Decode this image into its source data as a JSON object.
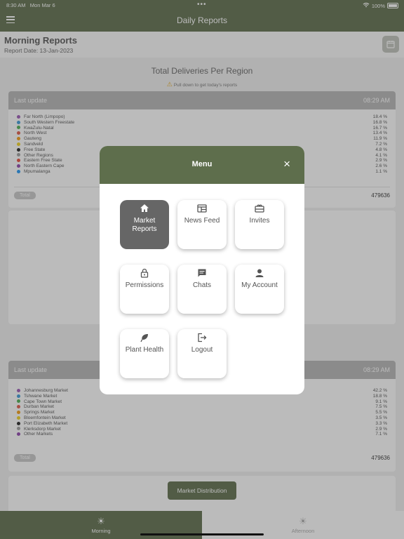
{
  "status_bar": {
    "time": "8:30 AM",
    "date": "Mon Mar 6",
    "battery": "100%"
  },
  "nav": {
    "title": "Daily Reports"
  },
  "header": {
    "title": "Morning Reports",
    "report_date": "Report Date: 13-Jan-2023"
  },
  "section": {
    "title": "Total Deliveries Per Region",
    "hint": "Pull down to get today's reports"
  },
  "region_card": {
    "last_update_label": "Last update",
    "time": "08:29 AM",
    "total_label": "Total",
    "total_value": "479636",
    "items": [
      {
        "name": "Far North (Limpopo)",
        "percent": "18.4 %",
        "color": "#9b59b6"
      },
      {
        "name": "South Western Freestate",
        "percent": "16.8 %",
        "color": "#3b9ad9"
      },
      {
        "name": "KwaZulu-Natal",
        "percent": "16.7 %",
        "color": "#4caf50"
      },
      {
        "name": "North West",
        "percent": "13.4 %",
        "color": "#e05a47"
      },
      {
        "name": "Gauteng",
        "percent": "11.9 %",
        "color": "#f39c12"
      },
      {
        "name": "Sandveld",
        "percent": "7.2 %",
        "color": "#f1d321"
      },
      {
        "name": "Free State",
        "percent": "4.8 %",
        "color": "#222222"
      },
      {
        "name": "Other Regions",
        "percent": "4.1 %",
        "color": "#9e9e9e"
      },
      {
        "name": "Eastern Free State",
        "percent": "2.9 %",
        "color": "#e74c3c"
      },
      {
        "name": "North Eastern Cape",
        "percent": "2.6 %",
        "color": "#8e44ad"
      },
      {
        "name": "Mpumalanga",
        "percent": "1.1 %",
        "color": "#2196f3"
      }
    ]
  },
  "market_card": {
    "last_update_label": "Last update",
    "time": "08:29 AM",
    "total_label": "Total",
    "total_value": "479636",
    "items": [
      {
        "name": "Johannesburg Market",
        "percent": "42.2 %",
        "color": "#9b59b6"
      },
      {
        "name": "Tshwane Market",
        "percent": "18.8 %",
        "color": "#3b9ad9"
      },
      {
        "name": "Cape Town Market",
        "percent": "9.1 %",
        "color": "#4caf50"
      },
      {
        "name": "Durban Market",
        "percent": "7.5 %",
        "color": "#e05a47"
      },
      {
        "name": "Springs Market",
        "percent": "5.5 %",
        "color": "#f39c12"
      },
      {
        "name": "Bloemfontein Market",
        "percent": "3.5 %",
        "color": "#f1d321"
      },
      {
        "name": "Port Elizabeth Market",
        "percent": "3.3 %",
        "color": "#222222"
      },
      {
        "name": "Klerksdorp Market",
        "percent": "2.9 %",
        "color": "#9e9e9e"
      },
      {
        "name": "Other Markets",
        "percent": "7.1 %",
        "color": "#8e44ad"
      }
    ]
  },
  "market_distribution_button": "Market Distribution",
  "tabs": {
    "morning": "Morning",
    "afternoon": "Afternoon"
  },
  "menu": {
    "title": "Menu",
    "items": [
      {
        "label": "Market Reports",
        "icon": "home-icon",
        "active": true
      },
      {
        "label": "News Feed",
        "icon": "news-icon",
        "active": false
      },
      {
        "label": "Invites",
        "icon": "invite-icon",
        "active": false
      },
      {
        "label": "Permissions",
        "icon": "lock-icon",
        "active": false
      },
      {
        "label": "Chats",
        "icon": "chat-icon",
        "active": false
      },
      {
        "label": "My Account",
        "icon": "user-icon",
        "active": false
      },
      {
        "label": "Plant Health",
        "icon": "leaf-icon",
        "active": false
      },
      {
        "label": "Logout",
        "icon": "logout-icon",
        "active": false
      }
    ]
  },
  "colors": {
    "brand": "#5e6e4c",
    "active_tile": "#666666"
  }
}
